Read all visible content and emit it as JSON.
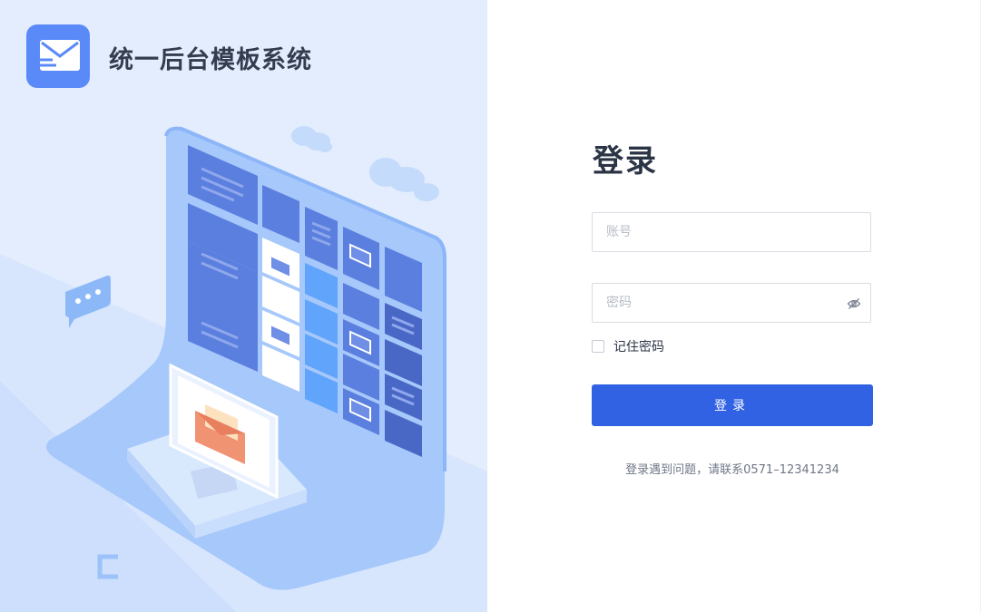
{
  "brand": {
    "title": "统一后台模板系统",
    "logo_icon": "mail-icon",
    "logo_color": "#5a8af8"
  },
  "login": {
    "title": "登录",
    "username_placeholder": "账号",
    "password_placeholder": "密码",
    "password_toggle_icon": "eye-off-icon",
    "remember_label": "记住密码",
    "remember_checked": false,
    "submit_label": "登录",
    "help_text": "登录遇到问题，请联系0571–12341234",
    "accent_color": "#3162e4"
  }
}
